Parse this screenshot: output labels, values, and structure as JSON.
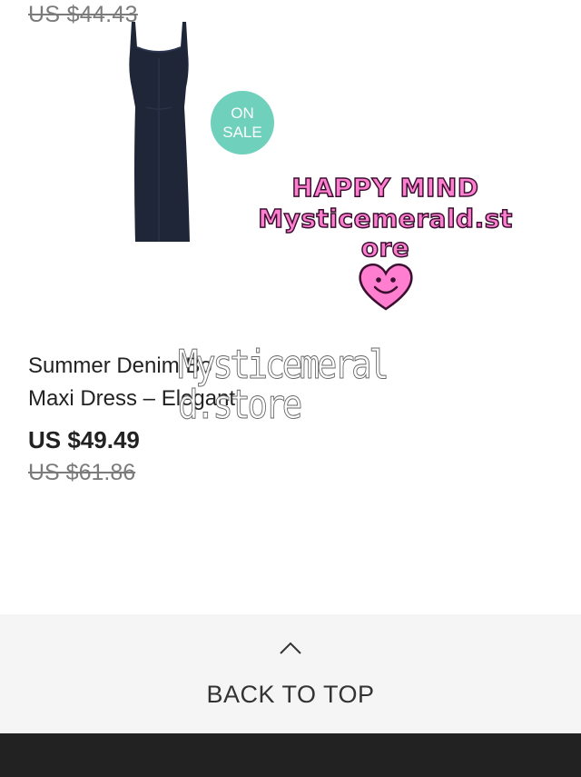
{
  "previous_item": {
    "original_price": "US $44.43"
  },
  "product": {
    "badge": [
      "ON",
      "SALE"
    ],
    "title_line1": "Summer Denim Bo",
    "title_line2": "Maxi Dress – Elegant",
    "price_current": "US $49.49",
    "price_original": "US $61.86",
    "image_icon": "navy-maxi-dress-image"
  },
  "watermark": {
    "line1": "HAPPY MIND",
    "line2": "Mysticemerald.st",
    "line3": "ore",
    "overlay_line1": "Mysticemeral",
    "overlay_line2": "d.store"
  },
  "back_to_top": {
    "label": "BACK TO TOP",
    "icon": "chevron-up-icon"
  },
  "colors": {
    "badge": "#6fd0bc",
    "watermark_pink": "#ff7ed0",
    "footer": "#222222",
    "back_to_top_bg": "#f5f5f5"
  }
}
